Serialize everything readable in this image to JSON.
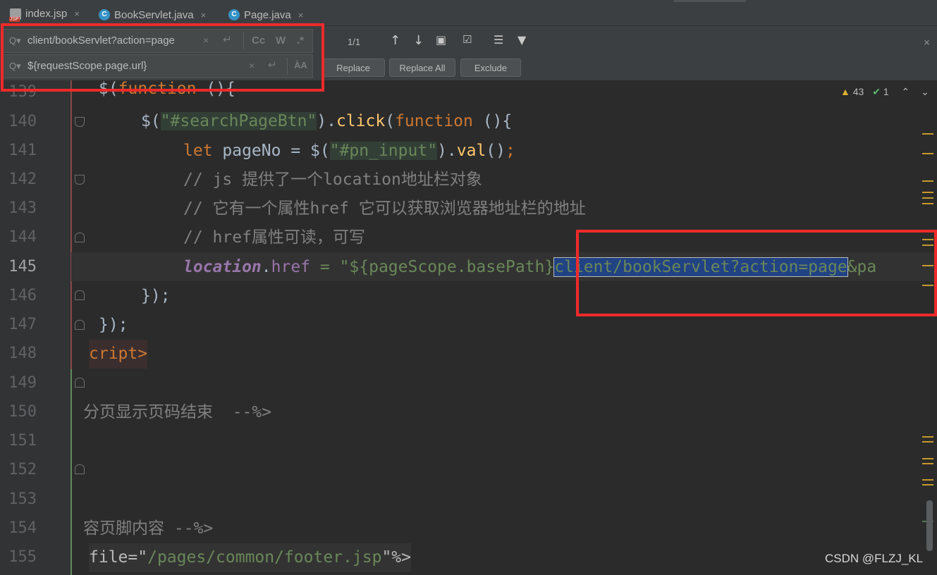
{
  "tabs": [
    {
      "label": "index.jsp",
      "close": "×"
    },
    {
      "label": "BookServlet.java",
      "close": "×"
    },
    {
      "label": "Page.java",
      "close": "×"
    }
  ],
  "find": {
    "search_value": "client/bookServlet?action=page",
    "replace_value": "${requestScope.page.url}",
    "match_count": "1/1",
    "opt_case": "Cc",
    "opt_words": "W",
    "opt_regex": ".*",
    "opt_preserve": "ÀA",
    "replace_label": "Replace",
    "replace_all_label": "Replace All",
    "exclude_label": "Exclude",
    "clear": "×",
    "close": "×"
  },
  "inspections": {
    "warnings": "43",
    "ok": "1"
  },
  "lines": [
    {
      "n": "139"
    },
    {
      "n": "140"
    },
    {
      "n": "141"
    },
    {
      "n": "142"
    },
    {
      "n": "143"
    },
    {
      "n": "144"
    },
    {
      "n": "145"
    },
    {
      "n": "146"
    },
    {
      "n": "147"
    },
    {
      "n": "148"
    },
    {
      "n": "149"
    },
    {
      "n": "150"
    },
    {
      "n": "151"
    },
    {
      "n": "152"
    },
    {
      "n": "153"
    },
    {
      "n": "154"
    },
    {
      "n": "155"
    }
  ],
  "code": {
    "l139": {
      "a": "$(",
      "b": "function",
      "c": " (){"
    },
    "l140": {
      "a": "$(",
      "b": "\"#searchPageBtn\"",
      "c": ").",
      "d": "click",
      "e": "(",
      "f": "function",
      "g": " (){"
    },
    "l141": {
      "a": "let",
      "b": " pageNo = $(",
      "c": "\"#pn_input\"",
      "d": ").",
      "e": "val",
      "f": "()",
      "g": ";"
    },
    "l142": "// js 提供了一个location地址栏对象",
    "l143": "// 它有一个属性href 它可以获取浏览器地址栏的地址",
    "l144": "// href属性可读，可写",
    "l145": {
      "a": "location",
      "b": ".",
      "c": "href",
      "d": " = \"${pageScope.basePath}",
      "e": "client/bookServlet?action=page",
      "f": "&pa"
    },
    "l146": {
      "a": "});",
      "b": ""
    },
    "l147": {
      "a": "});"
    },
    "l148": "cript>",
    "l150": "分页显示页码结束  --%>",
    "l154": "容页脚内容 --%>",
    "l155": {
      "a": "file=\"",
      "b": "/pages/common/footer.jsp",
      "c": "\"%>"
    }
  },
  "watermark": "CSDN @FLZJ_KL"
}
